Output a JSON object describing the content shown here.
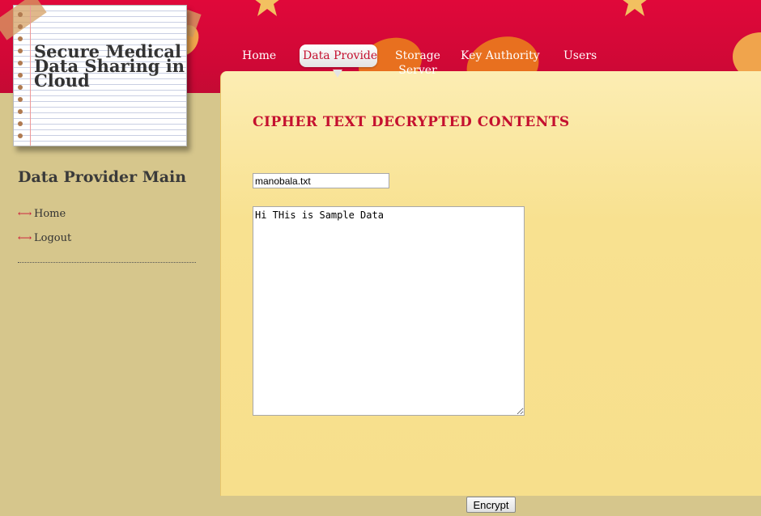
{
  "site": {
    "title_line1": "Secure Medical",
    "title_line2": "Data Sharing in",
    "title_line3": "Cloud"
  },
  "nav": {
    "items": [
      {
        "label": "Home"
      },
      {
        "label": "Data Provider",
        "active": true
      },
      {
        "label": "Storage Server"
      },
      {
        "label": "Key Authority"
      },
      {
        "label": "Users"
      }
    ]
  },
  "sidebar": {
    "title": "Data Provider Main",
    "items": [
      {
        "label": "Home"
      },
      {
        "label": "Logout"
      }
    ]
  },
  "main": {
    "heading": "CIPHER TEXT DECRYPTED CONTENTS",
    "filename_value": "manobala.txt",
    "content_value": "Hi THis is Sample Data",
    "button_label": "Encrypt"
  },
  "colors": {
    "header_red": "#d6083a",
    "accent_red": "#c4102f",
    "content_bg": "#f8e190",
    "sidebar_bg": "#d6c68c"
  }
}
